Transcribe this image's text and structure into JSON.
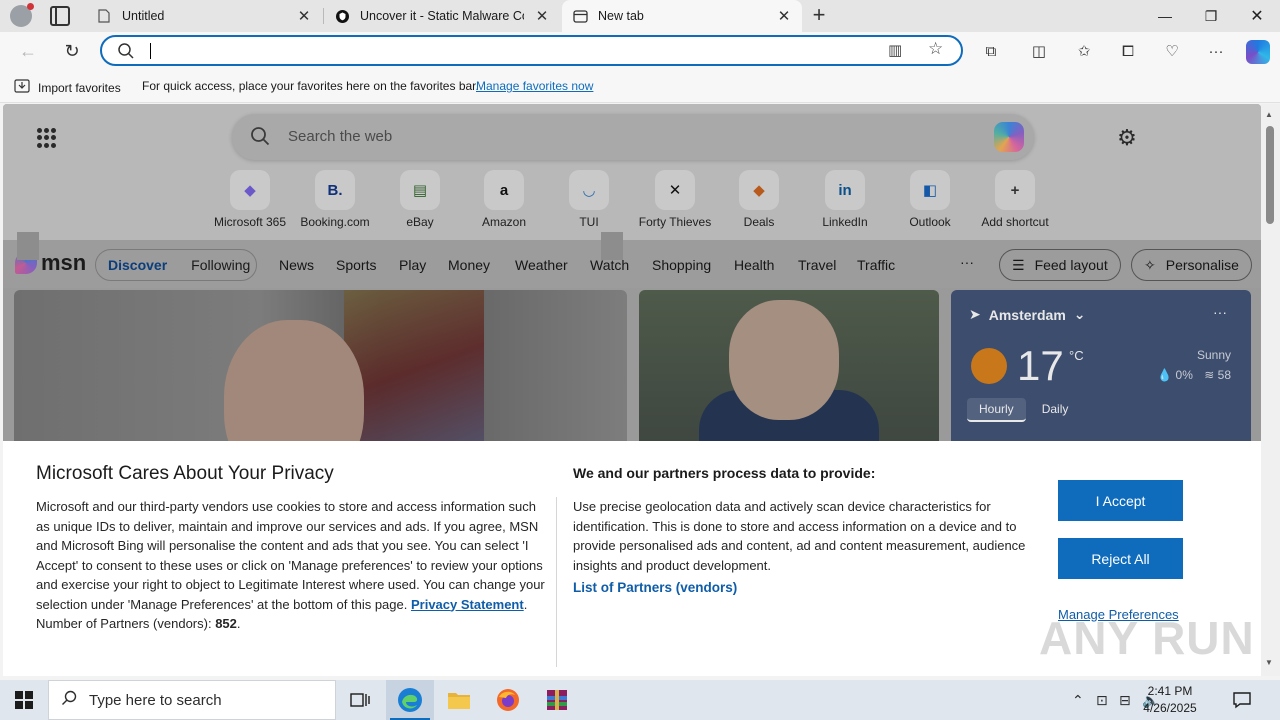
{
  "browser": {
    "tabs": [
      {
        "title": "Untitled",
        "favicon": "page-icon"
      },
      {
        "title": "Uncover it - Static Malware Confi",
        "favicon": "shield-icon"
      },
      {
        "title": "New tab",
        "favicon": "newtab-icon"
      }
    ],
    "active_tab": 2,
    "address": {
      "value": "",
      "placeholder": ""
    }
  },
  "favorites_bar": {
    "import_label": "Import favorites",
    "message": "For quick access, place your favorites here on the favorites bar.",
    "manage_link": "Manage favorites now"
  },
  "newtab": {
    "search_placeholder": "Search the web",
    "shortcuts": [
      {
        "label": "Microsoft 365",
        "icon": "m365-icon",
        "glyph": "◆",
        "color": "#6b59c9"
      },
      {
        "label": "Booking.com",
        "icon": "booking-icon",
        "glyph": "B.",
        "color": "#10307a"
      },
      {
        "label": "eBay",
        "icon": "ebay-icon",
        "glyph": "▤",
        "color": "#2f5f2a"
      },
      {
        "label": "Amazon",
        "icon": "amazon-icon",
        "glyph": "a",
        "color": "#111111"
      },
      {
        "label": "TUI",
        "icon": "tui-icon",
        "glyph": "◡",
        "color": "#2b6cb0"
      },
      {
        "label": "Forty Thieves",
        "icon": "swords-icon",
        "glyph": "✕",
        "color": "#111111"
      },
      {
        "label": "Deals",
        "icon": "deals-icon",
        "glyph": "◆",
        "color": "#b85a1c"
      },
      {
        "label": "LinkedIn",
        "icon": "linkedin-icon",
        "glyph": "in",
        "color": "#0a4f8a"
      },
      {
        "label": "Outlook",
        "icon": "outlook-icon",
        "glyph": "◧",
        "color": "#1558a8"
      },
      {
        "label": "Add shortcut",
        "icon": "plus-icon",
        "glyph": "+",
        "color": "#333333"
      }
    ]
  },
  "msn": {
    "logo": "msn",
    "feed_tabs": [
      "Discover",
      "Following"
    ],
    "nav": [
      "News",
      "Sports",
      "Play",
      "Money",
      "Weather",
      "Watch",
      "Shopping",
      "Health",
      "Travel",
      "Traffic"
    ],
    "more": "···",
    "feed_layout": "Feed layout",
    "personalise": "Personalise"
  },
  "weather": {
    "location": "Amsterdam",
    "temp": "17",
    "unit": "°C",
    "condition": "Sunny",
    "precip": "0%",
    "aqi": "58",
    "tabs": [
      "Hourly",
      "Daily"
    ],
    "menu": "···"
  },
  "privacy": {
    "title": "Microsoft Cares About Your Privacy",
    "body": "Microsoft and our third-party vendors use cookies to store and access information such as unique IDs to deliver, maintain and improve our services and ads. If you agree, MSN and Microsoft Bing will personalise the content and ads that you see. You can select 'I Accept' to consent to these uses or click on 'Manage preferences' to review your options and exercise your right to object to Legitimate Interest where used. You can change your selection under 'Manage Preferences' at the bottom of this page.",
    "privacy_link": "Privacy Statement",
    "partners_label": "Number of Partners (vendors):",
    "partners_count": "852",
    "right_title": "We and our partners process data to provide:",
    "right_body": "Use precise geolocation data and actively scan device characteristics for identification. This is done to store and access information on a device and to provide personalised ads and content, ad and content measurement, audience insights and product development.",
    "partners_link": "List of Partners (vendors)",
    "accept": "I Accept",
    "reject": "Reject All",
    "manage": "Manage Preferences"
  },
  "watermark": "ANY RUN",
  "taskbar": {
    "search_placeholder": "Type here to search",
    "time": "2:41 PM",
    "date": "4/26/2025"
  }
}
